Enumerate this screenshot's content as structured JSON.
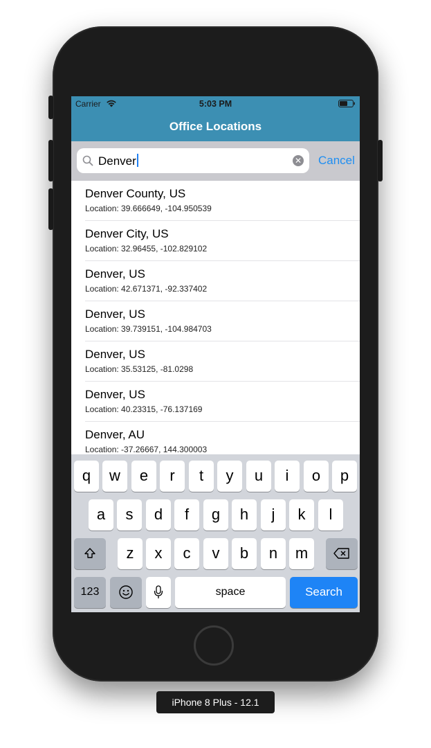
{
  "device_label": "iPhone 8 Plus - 12.1",
  "status_bar": {
    "carrier": "Carrier",
    "time": "5:03 PM",
    "wifi_icon": "wifi-icon",
    "battery_icon": "battery-icon"
  },
  "nav": {
    "title": "Office Locations"
  },
  "search": {
    "value": "Denver",
    "cancel_label": "Cancel",
    "search_icon": "search-icon",
    "clear_icon": "clear-icon"
  },
  "results": [
    {
      "title": "Denver County, US",
      "location": "Location: 39.666649, -104.950539"
    },
    {
      "title": "Denver City, US",
      "location": "Location: 32.96455, -102.829102"
    },
    {
      "title": "Denver, US",
      "location": "Location: 42.671371, -92.337402"
    },
    {
      "title": "Denver, US",
      "location": "Location: 39.739151, -104.984703"
    },
    {
      "title": "Denver, US",
      "location": "Location: 35.53125, -81.0298"
    },
    {
      "title": "Denver, US",
      "location": "Location: 40.23315, -76.137169"
    },
    {
      "title": "Denver, AU",
      "location": "Location: -37.26667, 144.300003"
    }
  ],
  "keyboard": {
    "row1": [
      "q",
      "w",
      "e",
      "r",
      "t",
      "y",
      "u",
      "i",
      "o",
      "p"
    ],
    "row2": [
      "a",
      "s",
      "d",
      "f",
      "g",
      "h",
      "j",
      "k",
      "l"
    ],
    "row3": [
      "z",
      "x",
      "c",
      "v",
      "b",
      "n",
      "m"
    ],
    "numbers_label": "123",
    "space_label": "space",
    "search_label": "Search"
  },
  "colors": {
    "nav_bg": "#3c8fb3",
    "accent": "#1f8ef1",
    "search_key": "#1e84f6"
  }
}
